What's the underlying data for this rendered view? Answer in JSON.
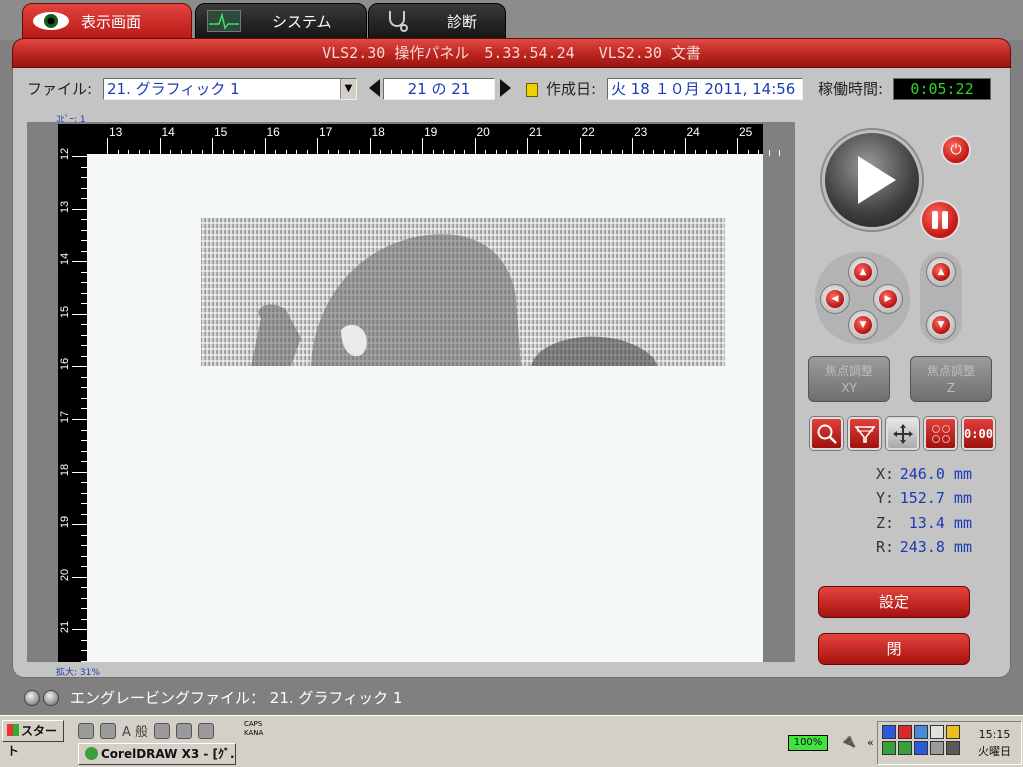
{
  "tabs": [
    {
      "label": "表示画面"
    },
    {
      "label": "システム"
    },
    {
      "label": "診断"
    }
  ],
  "banner": {
    "title": "VLS2.30 操作パネル　5.33.54.24　 VLS2.30 文書"
  },
  "file_row": {
    "file_label": "ファイル:",
    "file_value": "21. グラフィック 1",
    "page_value": "21 の 21",
    "created_label": "作成日:",
    "created_value": "火 18 １０月 2011, 14:56",
    "runtime_label": "稼働時間:",
    "runtime_value": "0:05:22"
  },
  "canvas": {
    "copies_label": "ｺﾋﾟｰ: 1",
    "zoom_label": "拡大: 31%",
    "h_ruler_labels": [
      "13",
      "14",
      "15",
      "16",
      "17",
      "18",
      "19",
      "20",
      "21",
      "22",
      "23",
      "24",
      "25"
    ],
    "v_ruler_labels": [
      "12",
      "13",
      "14",
      "15",
      "16",
      "17",
      "18",
      "19",
      "20",
      "21"
    ]
  },
  "controls": {
    "focus_xy_label": "焦点調整\nXY",
    "focus_z_label": "焦点調整\nZ",
    "timer_label": "0:00"
  },
  "coords": {
    "x": {
      "key": "X:",
      "value": "246.0 mm"
    },
    "y": {
      "key": "Y:",
      "value": "152.7 mm"
    },
    "z": {
      "key": "Z:",
      "value": "13.4 mm"
    },
    "r": {
      "key": "R:",
      "value": "243.8 mm"
    }
  },
  "buttons": {
    "settings": "設定",
    "close": "閉"
  },
  "status": {
    "text": "エングレービングファイル： 21. グラフィック 1"
  },
  "taskbar": {
    "start_label": "スタート",
    "ql_text": "A 般",
    "caps": "CAPS",
    "kana": "KANA",
    "app_label": "CorelDRAW X3 - [ｸﾞ...",
    "battery": "100%",
    "clock_time": "15:15",
    "clock_day": "火曜日"
  },
  "colors": {
    "accent_red": "#c8201b",
    "value_blue": "#1a3bb5",
    "runtime_green": "#27d827"
  }
}
